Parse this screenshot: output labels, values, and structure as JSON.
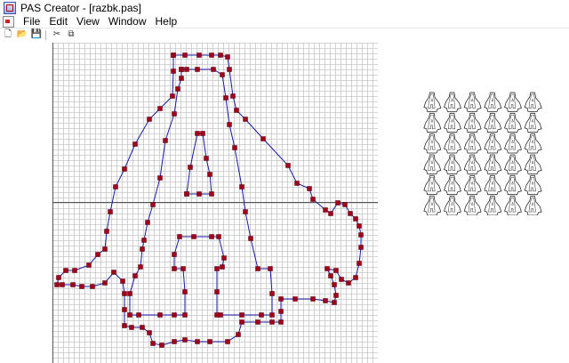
{
  "window": {
    "title": "PAS Creator - [razbk.pas]"
  },
  "menu": {
    "items": [
      "File",
      "Edit",
      "View",
      "Window",
      "Help"
    ]
  },
  "toolbar": {
    "buttons": [
      {
        "name": "new-file",
        "glyph": "🗋"
      },
      {
        "name": "open-folder",
        "glyph": "📂"
      },
      {
        "name": "save",
        "glyph": "💾"
      },
      {
        "name": "cut",
        "glyph": "✂"
      },
      {
        "name": "copy",
        "glyph": "⧉"
      }
    ]
  },
  "colors": {
    "grid": "#c6c6c6",
    "axis": "#555555",
    "path": "#1a1aa0",
    "point": "#a00018",
    "point_border": "#5a0010"
  },
  "sprite_preview": {
    "rows": 6,
    "cols": 6
  },
  "editor": {
    "point_groups": [
      [
        [
          195,
          62
        ],
        [
          208,
          62
        ],
        [
          224,
          62
        ],
        [
          238,
          62
        ],
        [
          248,
          62
        ],
        [
          256,
          64
        ],
        [
          258,
          78
        ],
        [
          262,
          108
        ],
        [
          266,
          124
        ],
        [
          276,
          134
        ],
        [
          296,
          156
        ],
        [
          324,
          186
        ],
        [
          334,
          206
        ],
        [
          348,
          212
        ],
        [
          352,
          224
        ],
        [
          366,
          236
        ],
        [
          372,
          240
        ],
        [
          380,
          228
        ],
        [
          388,
          230
        ],
        [
          394,
          240
        ],
        [
          400,
          246
        ],
        [
          404,
          254
        ],
        [
          406,
          264
        ],
        [
          406,
          278
        ],
        [
          404,
          296
        ],
        [
          400,
          312
        ],
        [
          392,
          318
        ],
        [
          384,
          314
        ],
        [
          378,
          304
        ],
        [
          368,
          302
        ],
        [
          372,
          310
        ],
        [
          376,
          320
        ],
        [
          378,
          332
        ],
        [
          376,
          340
        ],
        [
          366,
          338
        ],
        [
          352,
          336
        ],
        [
          332,
          336
        ],
        [
          316,
          336
        ],
        [
          316,
          350
        ],
        [
          316,
          362
        ],
        [
          306,
          362
        ],
        [
          290,
          362
        ],
        [
          272,
          362
        ],
        [
          268,
          376
        ],
        [
          256,
          384
        ],
        [
          236,
          384
        ],
        [
          222,
          384
        ],
        [
          208,
          382
        ],
        [
          196,
          384
        ],
        [
          182,
          388
        ],
        [
          172,
          386
        ],
        [
          168,
          374
        ],
        [
          160,
          368
        ],
        [
          148,
          368
        ],
        [
          140,
          366
        ],
        [
          140,
          348
        ],
        [
          140,
          330
        ],
        [
          138,
          316
        ],
        [
          128,
          306
        ],
        [
          118,
          318
        ],
        [
          104,
          322
        ],
        [
          92,
          322
        ],
        [
          82,
          320
        ],
        [
          70,
          320
        ],
        [
          64,
          320
        ],
        [
          66,
          312
        ],
        [
          74,
          304
        ],
        [
          84,
          304
        ],
        [
          100,
          298
        ],
        [
          110,
          286
        ],
        [
          118,
          280
        ],
        [
          120,
          260
        ],
        [
          124,
          238
        ],
        [
          130,
          210
        ],
        [
          140,
          190
        ],
        [
          152,
          162
        ],
        [
          168,
          134
        ],
        [
          180,
          122
        ],
        [
          194,
          108
        ],
        [
          195,
          80
        ],
        [
          195,
          62
        ]
      ],
      [
        [
          204,
          78
        ],
        [
          210,
          78
        ],
        [
          222,
          78
        ],
        [
          240,
          78
        ],
        [
          250,
          84
        ],
        [
          254,
          110
        ],
        [
          258,
          140
        ],
        [
          264,
          166
        ],
        [
          272,
          210
        ],
        [
          276,
          238
        ],
        [
          282,
          268
        ],
        [
          290,
          302
        ],
        [
          304,
          302
        ],
        [
          306,
          330
        ],
        [
          306,
          354
        ],
        [
          294,
          354
        ],
        [
          272,
          354
        ],
        [
          248,
          354
        ],
        [
          244,
          354
        ],
        [
          244,
          328
        ],
        [
          244,
          302
        ],
        [
          250,
          300
        ],
        [
          252,
          290
        ],
        [
          246,
          266
        ],
        [
          238,
          266
        ],
        [
          218,
          266
        ],
        [
          202,
          266
        ],
        [
          196,
          286
        ],
        [
          196,
          302
        ],
        [
          206,
          302
        ],
        [
          208,
          328
        ],
        [
          208,
          354
        ],
        [
          196,
          354
        ],
        [
          180,
          354
        ],
        [
          156,
          354
        ],
        [
          146,
          354
        ],
        [
          146,
          330
        ],
        [
          152,
          310
        ],
        [
          158,
          300
        ],
        [
          160,
          280
        ],
        [
          162,
          270
        ],
        [
          166,
          250
        ],
        [
          172,
          230
        ],
        [
          180,
          200
        ],
        [
          186,
          158
        ],
        [
          196,
          128
        ],
        [
          200,
          100
        ],
        [
          204,
          88
        ],
        [
          204,
          78
        ]
      ],
      [
        [
          210,
          218
        ],
        [
          214,
          188
        ],
        [
          222,
          150
        ],
        [
          228,
          150
        ],
        [
          232,
          178
        ],
        [
          236,
          196
        ],
        [
          238,
          218
        ],
        [
          224,
          218
        ],
        [
          210,
          218
        ]
      ]
    ]
  }
}
